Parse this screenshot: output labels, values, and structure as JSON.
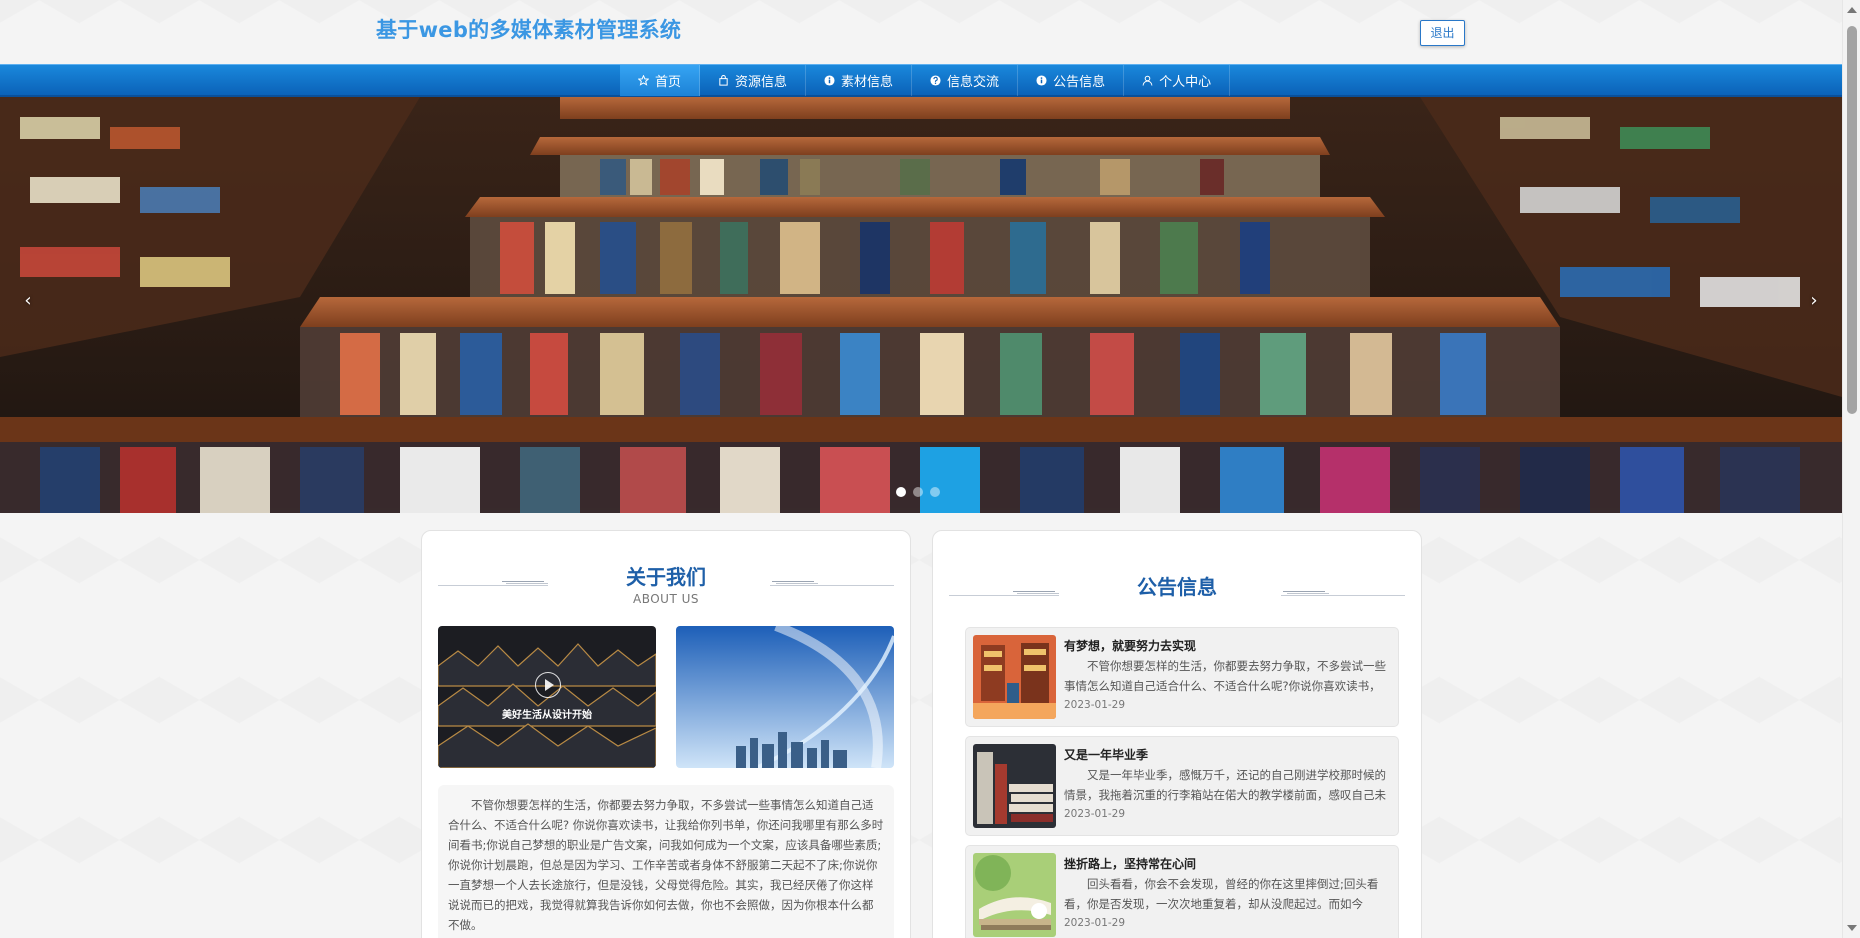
{
  "header": {
    "site_title": "基于web的多媒体素材管理系统",
    "logout_label": "退出"
  },
  "nav": {
    "items": [
      {
        "label": "首页",
        "icon": "star-icon",
        "active": true
      },
      {
        "label": "资源信息",
        "icon": "bag-icon"
      },
      {
        "label": "素材信息",
        "icon": "info-circle-icon"
      },
      {
        "label": "信息交流",
        "icon": "question-circle-icon"
      },
      {
        "label": "公告信息",
        "icon": "info-circle-icon"
      },
      {
        "label": "个人中心",
        "icon": "user-icon"
      }
    ]
  },
  "banner": {
    "prev_icon": "chevron-left-icon",
    "next_icon": "chevron-right-icon",
    "slide_count": 3,
    "active_slide": 1
  },
  "about": {
    "title": "关于我们",
    "subtitle": "ABOUT US",
    "image1_caption": "美好生活从设计开始",
    "text": "不管你想要怎样的生活，你都要去努力争取，不多尝试一些事情怎么知道自己适合什么、不适合什么呢? 你说你喜欢读书，让我给你列书单，你还问我哪里有那么多时间看书;你说自己梦想的职业是广告文案，问我如何成为一个文案，应该具备哪些素质;你说你计划晨跑，但总是因为学习、工作辛苦或者身体不舒服第二天起不了床;你说你一直梦想一个人去长途旅行，但是没钱，父母觉得危险。其实，我已经厌倦了你这样说说而已的把戏，我觉得就算我告诉你如何去做，你也不会照做，因为你根本什么都不做。"
  },
  "notice": {
    "title": "公告信息",
    "items": [
      {
        "title": "有梦想，就要努力去实现",
        "desc": "不管你想要怎样的生活，你都要去努力争取，不多尝试一些事情怎么知道自己适合什么、不适合什么呢?你说你喜欢读书，让我给你列书单",
        "date": "2023-01-29"
      },
      {
        "title": "又是一年毕业季",
        "desc": "又是一年毕业季，感慨万千，还记的自己刚进学校那时候的情景，我拖着沉重的行李箱站在偌大的教学楼前面，感叹自己未来的日子",
        "date": "2023-01-29"
      },
      {
        "title": "挫折路上，坚持常在心间",
        "desc": "回头看看，你会不会发现，曾经的你在这里摔倒过;回头看看，你是否发现，一次次地重复着，却从没爬起过。而如今",
        "date": "2023-01-29"
      }
    ]
  }
}
